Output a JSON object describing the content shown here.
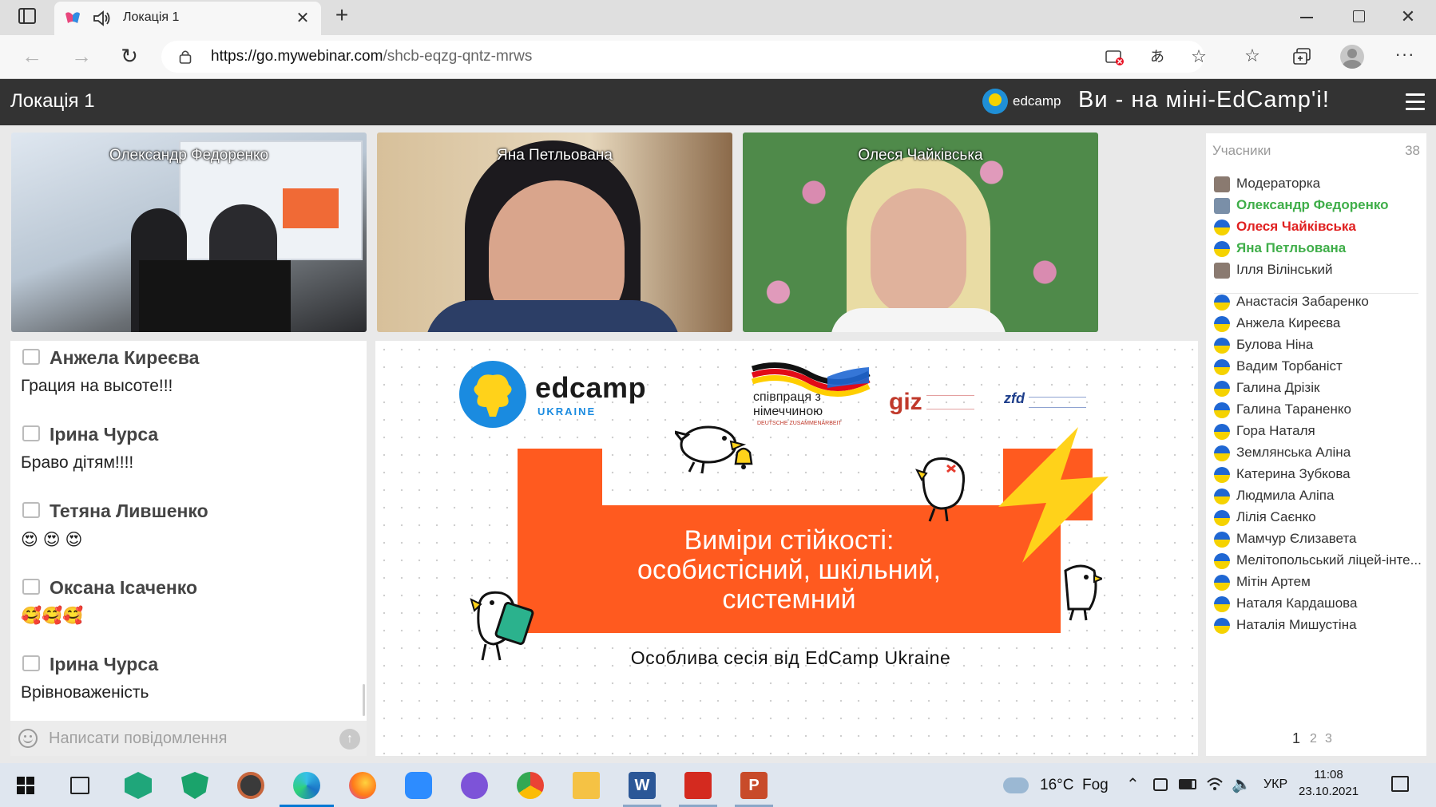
{
  "browser": {
    "tab_title": "Локація 1",
    "url_host": "https://go.mywebinar.com",
    "url_path": "/shcb-eqzg-qntz-mrws"
  },
  "app": {
    "room_title": "Локація 1",
    "logo_text": "edcamp",
    "tagline": "Ви - на міні-EdCamp'і!"
  },
  "videos": [
    {
      "name": "Олександр Федоренко"
    },
    {
      "name": "Яна Петльована"
    },
    {
      "name": "Олеся Чайківська"
    }
  ],
  "chat": {
    "messages": [
      {
        "author": "Анжела Киреєва",
        "text": "Грация на высоте!!!"
      },
      {
        "author": "Ірина Чурса",
        "text": "Браво дітям!!!!"
      },
      {
        "author": "Тетяна Лившенко",
        "text": "😍 😍 😍"
      },
      {
        "author": "Оксана Ісаченко",
        "text": "🥰🥰🥰"
      },
      {
        "author": "Ірина Чурса",
        "text": "Врівноваженість"
      }
    ],
    "input_placeholder": "Написати повідомлення"
  },
  "slide": {
    "brand_main": "edcamp",
    "brand_sub": "UKRAINE",
    "partner_1": "співпраця з німеччиною",
    "partner_1_sub": "DEUTSCHE ZUSAMMENARBEIT",
    "partner_2": "giz",
    "partner_3": "zfd",
    "title_line1": "Виміри стійкості:",
    "title_line2": "особистісний, шкільний,",
    "title_line3": "системний",
    "subtitle": "Особлива сесія від EdCamp Ukraine"
  },
  "participants": {
    "header": "Учасники",
    "count": "38",
    "hosts": [
      {
        "name": "Модераторка",
        "color": "#333333"
      },
      {
        "name": "Олександр Федоренко",
        "color": "#3fae49"
      },
      {
        "name": "Олеся Чайківська",
        "color": "#e02020"
      },
      {
        "name": "Яна Петльована",
        "color": "#3fae49"
      },
      {
        "name": "Ілля Вілінський",
        "color": "#333333"
      }
    ],
    "list": [
      "Анастасія Забаренко",
      "Анжела Киреєва",
      "Булова Ніна",
      "Вадим Торбаніст",
      "Галина Дрізік",
      "Галина Тараненко",
      "Гора Наталя",
      "Землянська Аліна",
      "Катерина Зубкова",
      "Людмила Аліпа",
      "Лілія Саєнко",
      "Мамчур Єлизавета",
      "Мелітопольський ліцей-інте...",
      "Мітін Артем",
      "Наталя Кардашова",
      "Наталія Мишустіна"
    ],
    "pages": [
      "1",
      "2",
      "3"
    ]
  },
  "taskbar": {
    "weather_temp": "16°C",
    "weather_desc": "Fog",
    "lang": "УКР",
    "time": "11:08",
    "date": "23.10.2021"
  },
  "colors": {
    "header_bg": "#333333",
    "slide_orange": "#ff5a1f",
    "bolt_yellow": "#ffd21a",
    "accent_blue": "#0078d4"
  }
}
